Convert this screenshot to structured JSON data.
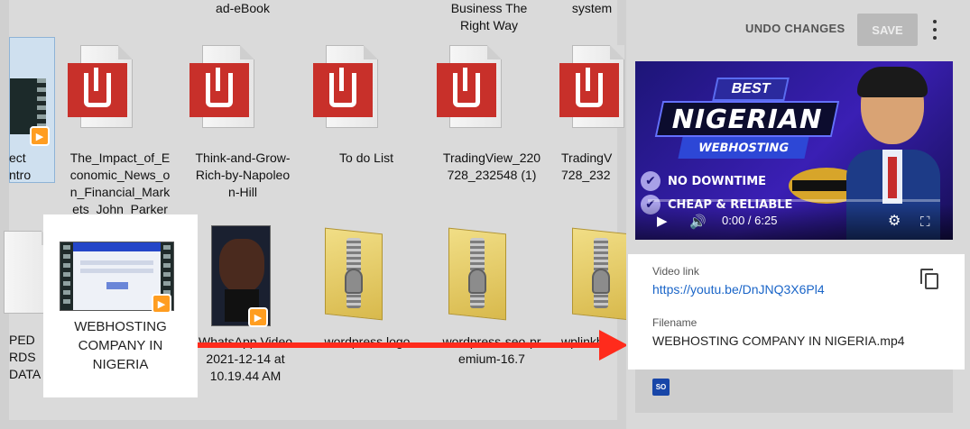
{
  "explorer": {
    "top_row_cut": [
      {
        "label": "ad-eBook"
      },
      {
        "label": "Business The\nRight Way"
      },
      {
        "label": "system"
      }
    ],
    "row1": [
      {
        "label": "ect\nntro"
      },
      {
        "label": "The_Impact_of_E\nconomic_News_o\nn_Financial_Mark\nets_John_Parker"
      },
      {
        "label": "Think-and-Grow-\nRich-by-Napoleo\nn-Hill"
      },
      {
        "label": "To do List"
      },
      {
        "label": "TradingView_220\n728_232548 (1)"
      },
      {
        "label": "TradingV\n728_232"
      }
    ],
    "row2": [
      {
        "label": "PED\nRDS\nDATA"
      },
      {
        "label": "WEBHOSTING\nCOMPANY IN\nNIGERIA"
      },
      {
        "label": "WhatsApp Video\n2021-12-14 at\n10.19.44 AM"
      },
      {
        "label": "wordpress logo"
      },
      {
        "label": "wordpress-seo-pr\nemium-16.7"
      },
      {
        "label": "wplinkb"
      }
    ]
  },
  "toolbar": {
    "undo_label": "UNDO CHANGES",
    "save_label": "SAVE"
  },
  "video": {
    "thumb_best": "BEST",
    "thumb_title": "NIGERIAN",
    "thumb_sub": "WEBHOSTING",
    "thumb_feature1": "NO DOWNTIME",
    "thumb_feature2": "CHEAP & RELIABLE",
    "time": "0:00 / 6:25",
    "progress": 0
  },
  "details": {
    "video_link_label": "Video link",
    "video_link": "https://youtu.be/DnJNQ3X6Pl4",
    "filename_label": "Filename",
    "filename": "WEBHOSTING COMPANY IN NIGERIA.mp4",
    "badge": "SO"
  },
  "colors": {
    "arrow": "#ff2b1c",
    "link": "#1a65c8",
    "pdf_badge": "#c8302a"
  }
}
